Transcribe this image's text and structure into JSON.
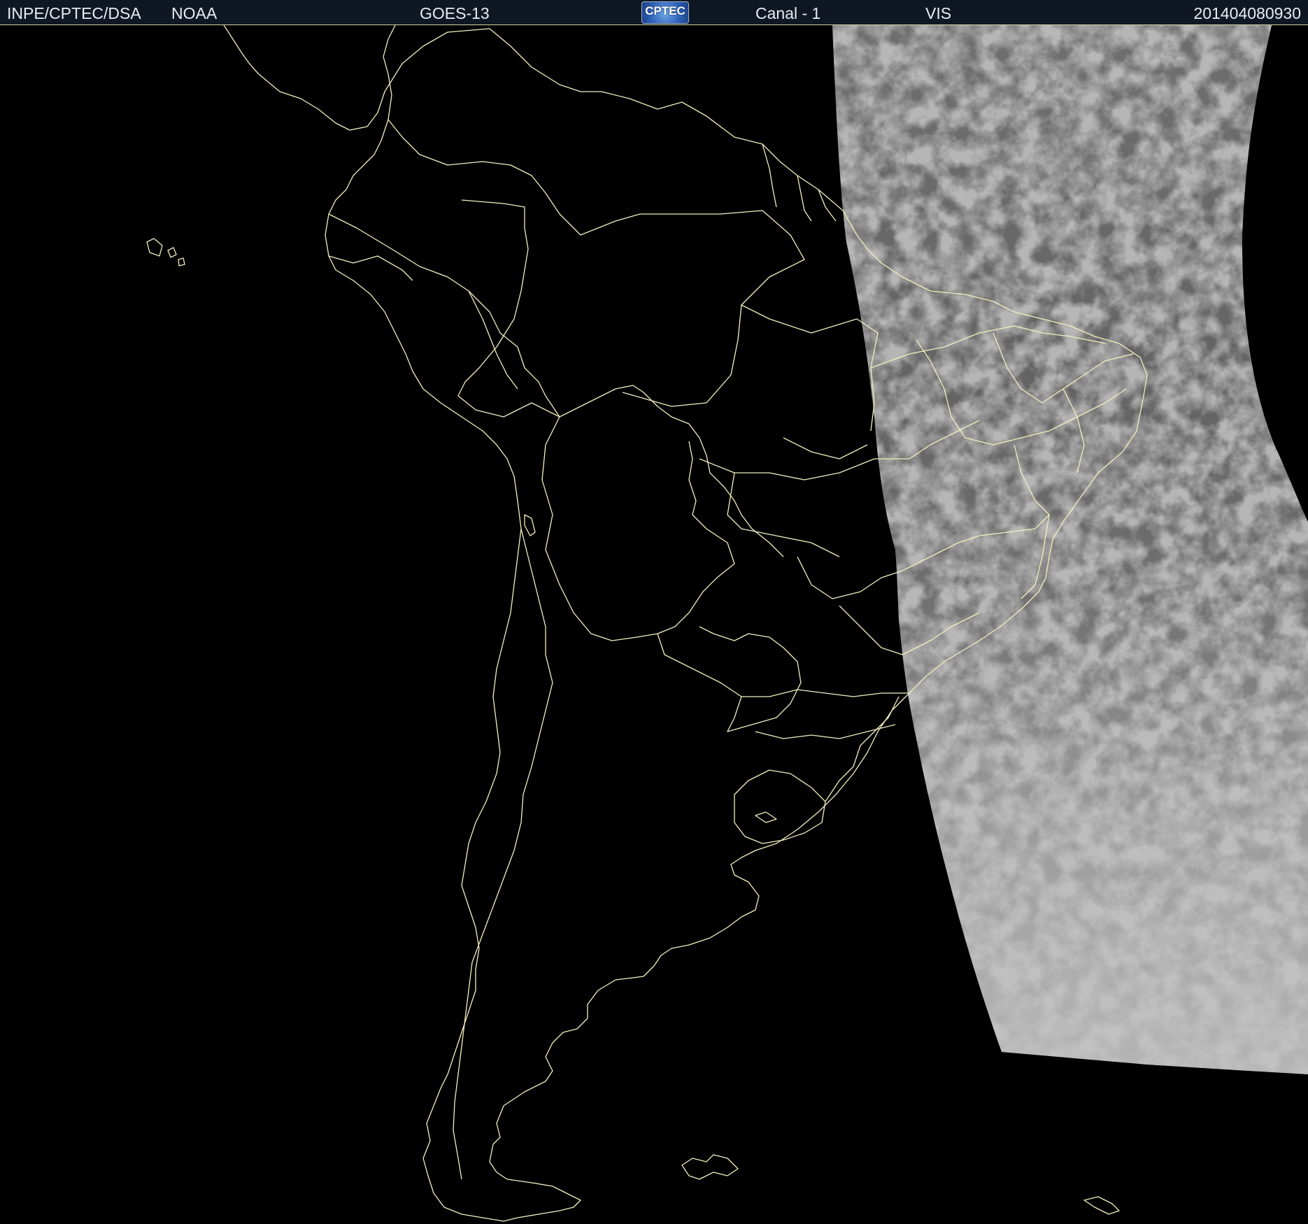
{
  "header": {
    "organization": "INPE/CPTEC/DSA",
    "agency": "NOAA",
    "satellite": "GOES-13",
    "logo_text": "CPTEC",
    "channel": "Canal - 1",
    "band": "VIS",
    "timestamp": "201404080930"
  },
  "colors": {
    "header_background": "#0f1822",
    "header_text": "#e8ecf2",
    "map_background": "#000000",
    "boundary_lines": "#f3efbf",
    "cloud_swath": "#8a8a8a"
  },
  "icons": {
    "logo": "cptec-logo"
  }
}
